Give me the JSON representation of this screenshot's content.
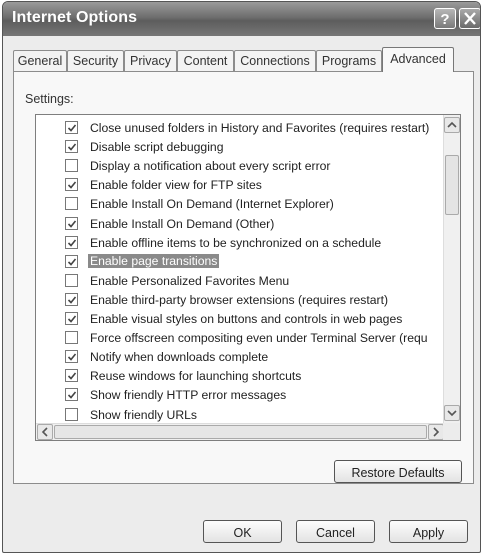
{
  "window": {
    "title": "Internet Options"
  },
  "tabs": [
    {
      "label": "General"
    },
    {
      "label": "Security"
    },
    {
      "label": "Privacy"
    },
    {
      "label": "Content"
    },
    {
      "label": "Connections"
    },
    {
      "label": "Programs"
    },
    {
      "label": "Advanced"
    }
  ],
  "active_tab": "Advanced",
  "settings": {
    "label": "Settings:",
    "items": [
      {
        "label": "Close unused folders in History and Favorites (requires restart)",
        "checked": true
      },
      {
        "label": "Disable script debugging",
        "checked": true
      },
      {
        "label": "Display a notification about every script error",
        "checked": false
      },
      {
        "label": "Enable folder view for FTP sites",
        "checked": true
      },
      {
        "label": "Enable Install On Demand (Internet Explorer)",
        "checked": false
      },
      {
        "label": "Enable Install On Demand (Other)",
        "checked": true
      },
      {
        "label": "Enable offline items to be synchronized on a schedule",
        "checked": true
      },
      {
        "label": "Enable page transitions",
        "checked": true,
        "selected": true
      },
      {
        "label": "Enable Personalized Favorites Menu",
        "checked": false
      },
      {
        "label": "Enable third-party browser extensions (requires restart)",
        "checked": true
      },
      {
        "label": "Enable visual styles on buttons and controls in web pages",
        "checked": true
      },
      {
        "label": "Force offscreen compositing even under Terminal Server (requ",
        "checked": false
      },
      {
        "label": "Notify when downloads complete",
        "checked": true
      },
      {
        "label": "Reuse windows for launching shortcuts",
        "checked": true
      },
      {
        "label": "Show friendly HTTP error messages",
        "checked": true
      },
      {
        "label": "Show friendly URLs",
        "checked": false
      }
    ]
  },
  "buttons": {
    "restore_defaults": "Restore Defaults",
    "ok": "OK",
    "cancel": "Cancel",
    "apply": "Apply"
  },
  "icons": {
    "help": "help-icon",
    "close": "close-icon",
    "scroll_up": "chevron-up-icon",
    "scroll_down": "chevron-down-icon",
    "scroll_left": "chevron-left-icon",
    "scroll_right": "chevron-right-icon"
  },
  "colors": {
    "titlebar": "#6e6e6e",
    "selection": "#8a8a8a",
    "panel": "#f8f8f8"
  }
}
